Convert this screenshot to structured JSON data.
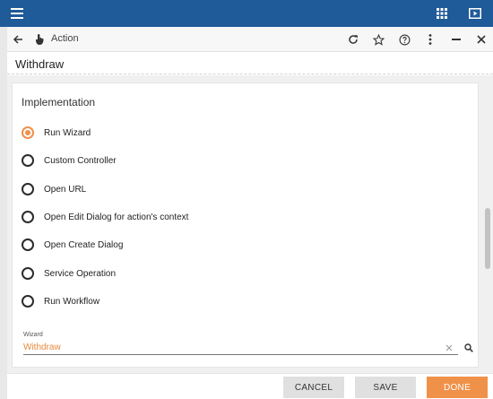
{
  "colors": {
    "topbar": "#1f5a99",
    "accent": "#f0904a",
    "done_button": "#f0914a"
  },
  "topbar": {
    "icons": [
      "hamburger-menu-icon",
      "apps-grid-icon",
      "play-icon"
    ]
  },
  "dialog": {
    "title": "Action",
    "icons": [
      "back-arrow-icon",
      "touch-hand-icon",
      "refresh-icon",
      "star-icon",
      "help-icon",
      "more-vert-icon",
      "minimize-icon",
      "close-icon"
    ]
  },
  "section": {
    "title": "Withdraw"
  },
  "card": {
    "title": "Implementation",
    "options": [
      {
        "label": "Run Wizard",
        "selected": true
      },
      {
        "label": "Custom Controller",
        "selected": false
      },
      {
        "label": "Open URL",
        "selected": false
      },
      {
        "label": "Open Edit Dialog for action's context",
        "selected": false
      },
      {
        "label": "Open Create Dialog",
        "selected": false
      },
      {
        "label": "Service Operation",
        "selected": false
      },
      {
        "label": "Run Workflow",
        "selected": false
      }
    ],
    "wizard_field": {
      "label": "Wizard",
      "value": "Withdraw"
    }
  },
  "footer": {
    "cancel_label": "CANCEL",
    "save_label": "SAVE",
    "done_label": "DONE"
  }
}
